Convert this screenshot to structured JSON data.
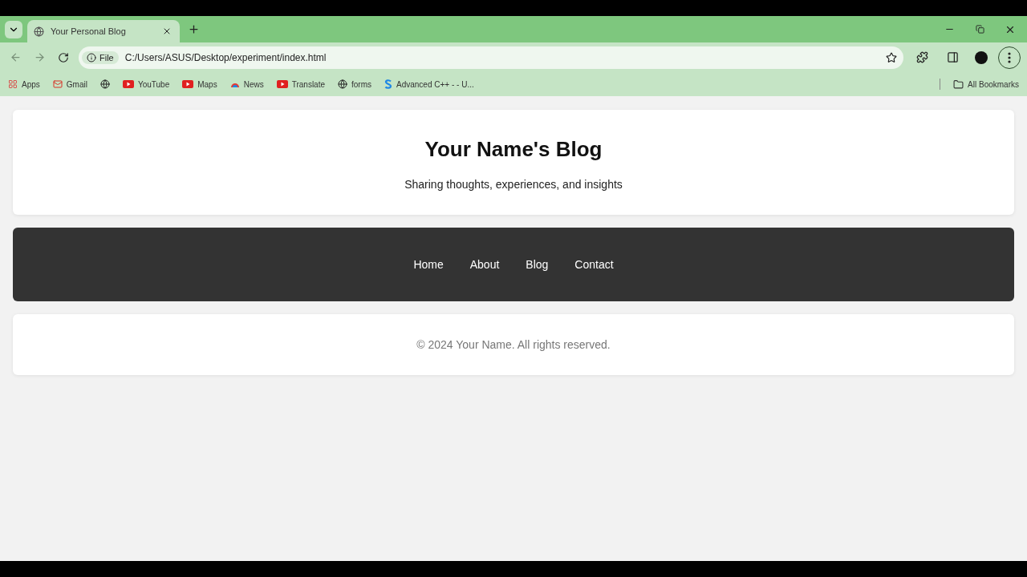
{
  "tab": {
    "title": "Your Personal Blog",
    "selected": true
  },
  "address_bar": {
    "scheme": "File",
    "url": "C:/Users/ASUS/Desktop/experiment/index.html"
  },
  "bookmarks": [
    {
      "kind": "apps",
      "label": "Apps"
    },
    {
      "kind": "gmail",
      "label": "Gmail"
    },
    {
      "kind": "globe"
    },
    {
      "kind": "video",
      "label": "YouTube"
    },
    {
      "kind": "video",
      "label": "Maps"
    },
    {
      "kind": "news",
      "label": "News"
    },
    {
      "kind": "video",
      "label": "Translate"
    },
    {
      "kind": "globe",
      "label": "forms"
    },
    {
      "kind": "s",
      "label": "Advanced C++ - - U..."
    }
  ],
  "all_bookmarks": "All Bookmarks",
  "header": {
    "title": "Your Name's Blog",
    "tagline": "Sharing thoughts, experiences, and insights"
  },
  "nav": [
    "Home",
    "About",
    "Blog",
    "Contact"
  ],
  "footer": "© 2024 Your Name. All rights reserved."
}
